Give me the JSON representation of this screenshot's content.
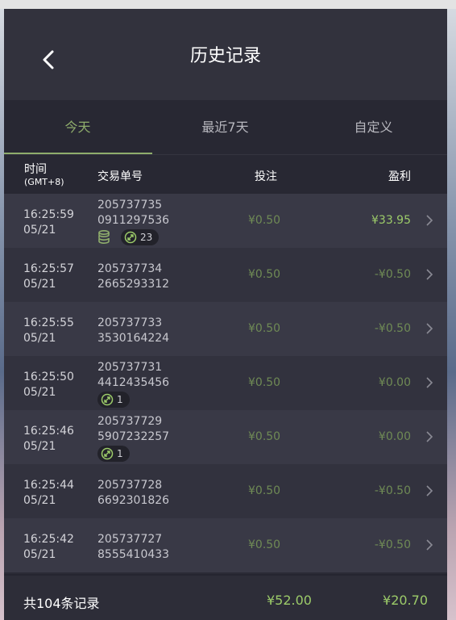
{
  "header": {
    "title": "历史记录",
    "back_icon": "chevron-left-icon"
  },
  "tabs": [
    {
      "label": "今天",
      "active": true
    },
    {
      "label": "最近7天",
      "active": false
    },
    {
      "label": "自定义",
      "active": false
    }
  ],
  "columns": {
    "time": "时间",
    "timezone": "(GMT+8)",
    "order": "交易单号",
    "bet": "投注",
    "profit": "盈利"
  },
  "rows": [
    {
      "time": "16:25:59",
      "date": "05/21",
      "order_1": "205737735",
      "order_2": "0911297536",
      "bet": "¥0.50",
      "profit": "¥33.95",
      "win": true,
      "coin_icon": true,
      "badge": "23"
    },
    {
      "time": "16:25:57",
      "date": "05/21",
      "order_1": "205737734",
      "order_2": "2665293312",
      "bet": "¥0.50",
      "profit": "-¥0.50",
      "win": false,
      "coin_icon": false,
      "badge": null
    },
    {
      "time": "16:25:55",
      "date": "05/21",
      "order_1": "205737733",
      "order_2": "3530164224",
      "bet": "¥0.50",
      "profit": "-¥0.50",
      "win": false,
      "coin_icon": false,
      "badge": null
    },
    {
      "time": "16:25:50",
      "date": "05/21",
      "order_1": "205737731",
      "order_2": "4412435456",
      "bet": "¥0.50",
      "profit": "¥0.00",
      "win": false,
      "coin_icon": false,
      "badge": "1"
    },
    {
      "time": "16:25:46",
      "date": "05/21",
      "order_1": "205737729",
      "order_2": "5907232257",
      "bet": "¥0.50",
      "profit": "¥0.00",
      "win": false,
      "coin_icon": false,
      "badge": "1"
    },
    {
      "time": "16:25:44",
      "date": "05/21",
      "order_1": "205737728",
      "order_2": "6692301826",
      "bet": "¥0.50",
      "profit": "-¥0.50",
      "win": false,
      "coin_icon": false,
      "badge": null
    },
    {
      "time": "16:25:42",
      "date": "05/21",
      "order_1": "205737727",
      "order_2": "8555410433",
      "bet": "¥0.50",
      "profit": "-¥0.50",
      "win": false,
      "coin_icon": false,
      "badge": null
    }
  ],
  "footer": {
    "total_label": "共104条记录",
    "total_bet": "¥52.00",
    "total_profit": "¥20.70"
  },
  "colors": {
    "accent_green": "#8fad6c",
    "win_green": "#9ccb69",
    "dim_green": "#6f8a55",
    "panel_bg": "#2b2b36",
    "row_odd": "#393946",
    "row_even": "#32323e"
  },
  "icons": {
    "row_arrow": "chevron-right-icon",
    "coin": "coin-stack-icon",
    "free_spin": "free-spin-icon"
  }
}
